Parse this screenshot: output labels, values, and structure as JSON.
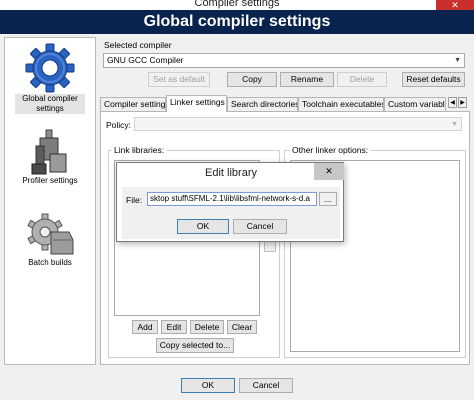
{
  "window": {
    "title": "Compiler settings",
    "close_glyph": "✕"
  },
  "header": {
    "title": "Global compiler settings"
  },
  "nav": [
    {
      "label_lines": [
        "Global compiler",
        "settings"
      ],
      "icon": "gear-icon",
      "selected": true
    },
    {
      "label_lines": [
        "Profiler settings"
      ],
      "icon": "profiler-icon",
      "selected": false
    },
    {
      "label_lines": [
        "Batch builds"
      ],
      "icon": "batch-gear-icon",
      "selected": false
    }
  ],
  "compiler": {
    "selected_label": "Selected compiler",
    "selected_value": "GNU GCC Compiler",
    "buttons": {
      "set_default": "Set as default",
      "copy": "Copy",
      "rename": "Rename",
      "delete": "Delete",
      "reset": "Reset defaults"
    }
  },
  "tabs": [
    "Compiler settings",
    "Linker settings",
    "Search directories",
    "Toolchain executables",
    "Custom variable"
  ],
  "active_tab": 1,
  "linker": {
    "policy_label": "Policy:",
    "link_libraries_label": "Link libraries:",
    "other_options_label": "Other linker options:",
    "buttons": {
      "add": "Add",
      "edit": "Edit",
      "delete": "Delete",
      "clear": "Clear",
      "copy_selected": "Copy selected to..."
    }
  },
  "dialog": {
    "title": "Edit library",
    "file_label": "File:",
    "file_value": "sktop stuff\\SFML-2.1\\lib\\libsfml-network-s-d.a",
    "browse": "...",
    "ok": "OK",
    "cancel": "Cancel"
  },
  "footer": {
    "ok": "OK",
    "cancel": "Cancel"
  },
  "colors": {
    "header_bg": "#08234d",
    "close_bg": "#c9302c",
    "accent": "#2c6fb6"
  }
}
